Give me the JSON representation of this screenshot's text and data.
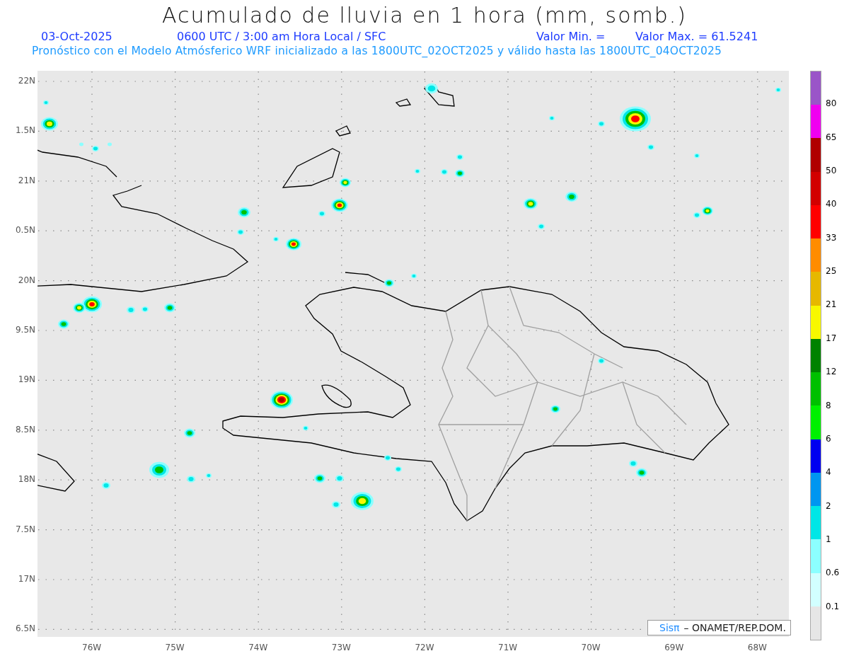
{
  "title": "Acumulado de lluvia en 1 hora (mm, somb.)",
  "info_line": [
    {
      "kind": "date",
      "text": "03-Oct-2025"
    },
    {
      "kind": "time",
      "text": "0600 UTC / 3:00 am Hora Local / SFC"
    },
    {
      "kind": "min",
      "text": "Valor Min. ="
    },
    {
      "kind": "max",
      "text": "Valor Max. = 61.5241"
    }
  ],
  "subtitle": "Pronóstico con el Modelo Atmósferico WRF inicializado a las 1800UTC_02OCT2025 y válido hasta las  1800UTC_04OCT2025",
  "y_labels": [
    "22N",
    "1.5N",
    "21N",
    "0.5N",
    "20N",
    "9.5N",
    "19N",
    "8.5N",
    "18N",
    "7.5N",
    "17N",
    "6.5N"
  ],
  "x_labels": [
    "76W",
    "75W",
    "74W",
    "73W",
    "72W",
    "71W",
    "70W",
    "69W",
    "68W"
  ],
  "credit": {
    "logo": "Sisπ",
    "text": "– ONAMET/REP.DOM."
  },
  "colorbar": [
    {
      "color": "#9a55c8",
      "label": "80"
    },
    {
      "color": "#f000f0",
      "label": "65"
    },
    {
      "color": "#b00000",
      "label": "50"
    },
    {
      "color": "#d20000",
      "label": "40"
    },
    {
      "color": "#ff0000",
      "label": "33"
    },
    {
      "color": "#ff8c00",
      "label": "25"
    },
    {
      "color": "#e6b800",
      "label": "21"
    },
    {
      "color": "#f8f800",
      "label": "17"
    },
    {
      "color": "#008200",
      "label": "12"
    },
    {
      "color": "#00c000",
      "label": "8"
    },
    {
      "color": "#00f000",
      "label": "6"
    },
    {
      "color": "#0000f0",
      "label": "4"
    },
    {
      "color": "#0096f0",
      "label": "2"
    },
    {
      "color": "#00e6e6",
      "label": "1"
    },
    {
      "color": "#8cffff",
      "label": "0.6"
    },
    {
      "color": "#d2ffff",
      "label": "0.1"
    },
    {
      "color": "#e6e6e6"
    }
  ]
}
